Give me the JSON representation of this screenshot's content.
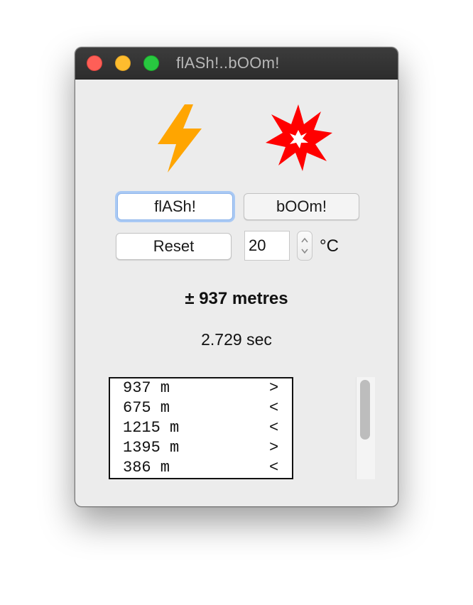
{
  "window": {
    "title": "flASh!..bOOm!"
  },
  "icons": {
    "lightning": "lightning-bolt-icon",
    "explosion": "explosion-icon",
    "lightning_color": "#ffa500",
    "explosion_color": "#ff0000"
  },
  "buttons": {
    "flash_label": "flASh!",
    "boom_label": "bOOm!",
    "reset_label": "Reset"
  },
  "temperature": {
    "value": "20",
    "unit": "°C"
  },
  "result": {
    "distance": "± 937 metres",
    "time": "2.729 sec"
  },
  "log": {
    "rows": [
      {
        "distance": "937 m",
        "direction": ">"
      },
      {
        "distance": "675 m",
        "direction": "<"
      },
      {
        "distance": "1215 m",
        "direction": "<"
      },
      {
        "distance": "1395 m",
        "direction": ">"
      },
      {
        "distance": "386 m",
        "direction": "<"
      }
    ]
  },
  "colors": {
    "focus_ring": "#a9c9f4",
    "title_bar": "#2d2d2d"
  }
}
